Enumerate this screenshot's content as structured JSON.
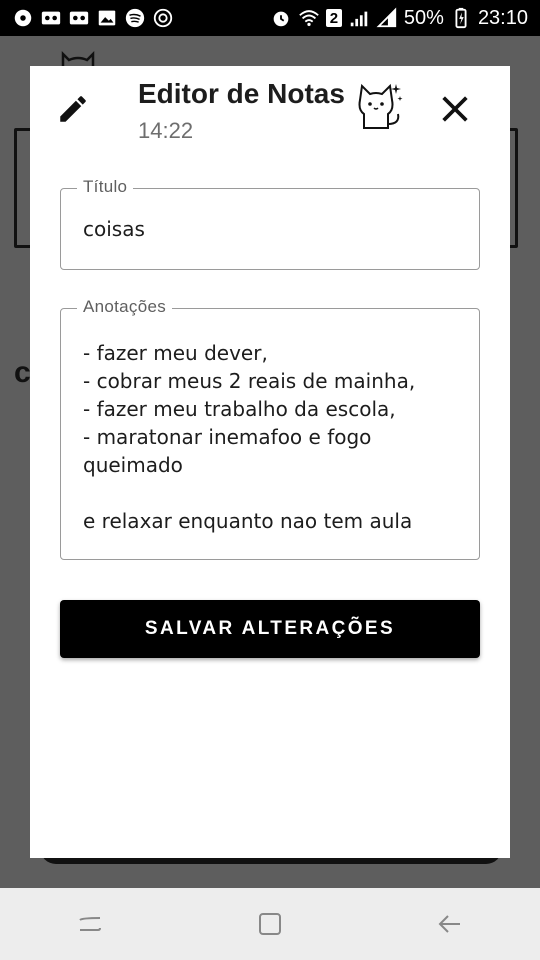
{
  "status_bar": {
    "battery": "50%",
    "time": "23:10",
    "sim_badge": "2",
    "left_icons": [
      "spotify-like-icon",
      "voicemail-icon",
      "voicemail-icon",
      "image-icon",
      "spotify-icon",
      "sync-icon"
    ],
    "right_icons": [
      "alarm-icon",
      "wifi-icon",
      "signal-icon",
      "signal-icon",
      "battery-icon"
    ]
  },
  "dialog": {
    "title": "Editor de Notas",
    "time": "14:22",
    "title_field": {
      "label": "Título",
      "value": "coisas"
    },
    "notes_field": {
      "label": "Anotações",
      "value": "- fazer meu dever,\n- cobrar meus 2 reais de mainha,\n- fazer meu trabalho da escola,\n- maratonar inemafoo e fogo queimado\n\ne relaxar enquanto nao tem aula"
    },
    "save_label": "SALVAR ALTERAÇÕES"
  },
  "background": {
    "letter": "c"
  },
  "colors": {
    "primary": "#000000",
    "overlay": "#5e5e5e",
    "nav_bar": "#ededed"
  }
}
